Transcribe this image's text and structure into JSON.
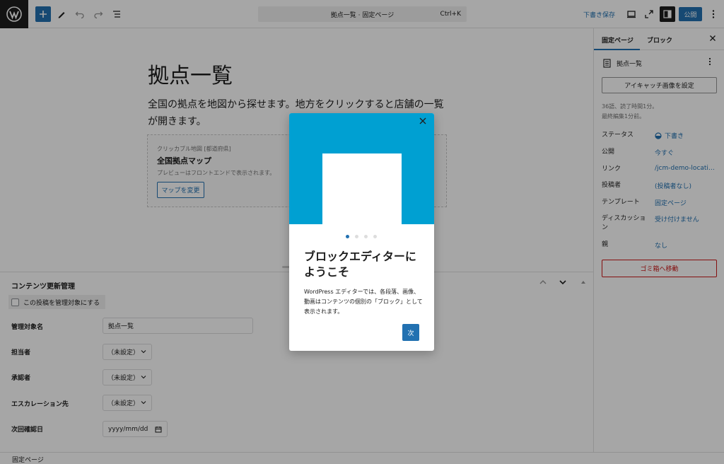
{
  "toolbar": {
    "command_title": "拠点一覧 · 固定ページ",
    "command_kbd": "Ctrl+K",
    "save_draft": "下書き保存",
    "publish": "公開"
  },
  "content": {
    "title": "拠点一覧",
    "description": "全国の拠点を地図から探せます。地方をクリックすると店舗の一覧が開きます。",
    "map_block": {
      "kicker": "クリッカブル地図 [都道府県]",
      "title": "全国拠点マップ",
      "note": "プレビューはフロントエンドで表示されます。",
      "button": "マップを変更"
    }
  },
  "metabox": {
    "title": "コンテンツ更新管理",
    "checkbox_label": "この投稿を管理対象にする",
    "fields": [
      {
        "label": "管理対象名",
        "value": "拠点一覧"
      },
      {
        "label": "担当者",
        "value": "（未設定）"
      },
      {
        "label": "承認者",
        "value": "（未設定）"
      },
      {
        "label": "エスカレーション先",
        "value": "（未設定）"
      },
      {
        "label": "次回確認日",
        "value": "yyyy/mm/dd"
      }
    ]
  },
  "footer": {
    "breadcrumb": "固定ページ"
  },
  "sidebar": {
    "tabs": [
      "固定ページ",
      "ブロック"
    ],
    "doc_title": "拠点一覧",
    "featured_image": "アイキャッチ画像を設定",
    "stats_line1": "36語、読了時間1分。",
    "stats_line2": "最終編集1分前。",
    "rows": [
      {
        "label": "ステータス",
        "value": "下書き"
      },
      {
        "label": "公開",
        "value": "今すぐ"
      },
      {
        "label": "リンク",
        "value": "/jcm-demo-locati…"
      },
      {
        "label": "投稿者",
        "value": "(投稿者なし)"
      },
      {
        "label": "テンプレート",
        "value": "固定ページ"
      },
      {
        "label": "ディスカッション",
        "value": "受け付けません"
      },
      {
        "label": "親",
        "value": "なし"
      }
    ],
    "trash": "ゴミ箱へ移動"
  },
  "modal": {
    "heading": "ブロックエディターにようこそ",
    "text": "WordPress エディターでは、各段落、画像、動画はコンテンツの個別の「ブロック」として表示されます。",
    "next": "次",
    "page_count": 4,
    "current_page": 1
  },
  "colors": {
    "accent": "#2271b1",
    "hero": "#00a0d2",
    "danger": "#cc1818"
  }
}
